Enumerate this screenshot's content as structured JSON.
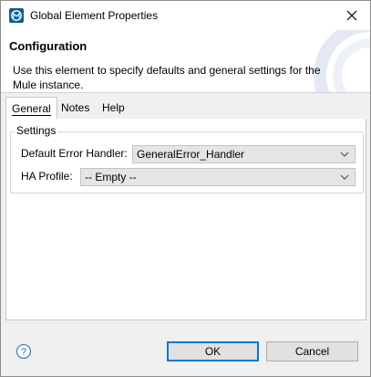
{
  "window": {
    "title": "Global Element Properties"
  },
  "banner": {
    "title": "Configuration",
    "description": "Use this element to specify defaults and general settings for the Mule instance."
  },
  "tabs": [
    {
      "label": "General",
      "active": true
    },
    {
      "label": "Notes",
      "active": false
    },
    {
      "label": "Help",
      "active": false
    }
  ],
  "settings": {
    "group_label": "Settings",
    "default_error_handler": {
      "label": "Default Error Handler:",
      "value": "GeneralError_Handler"
    },
    "ha_profile": {
      "label": "HA Profile:",
      "value": "-- Empty --"
    }
  },
  "footer": {
    "ok_label": "OK",
    "cancel_label": "Cancel"
  },
  "icons": {
    "app": "mule-app-icon",
    "close": "close-icon",
    "help": "help-icon",
    "dropdown": "chevron-down-icon"
  },
  "colors": {
    "accent": "#0078d7",
    "app_icon": "#0a5f8f"
  }
}
